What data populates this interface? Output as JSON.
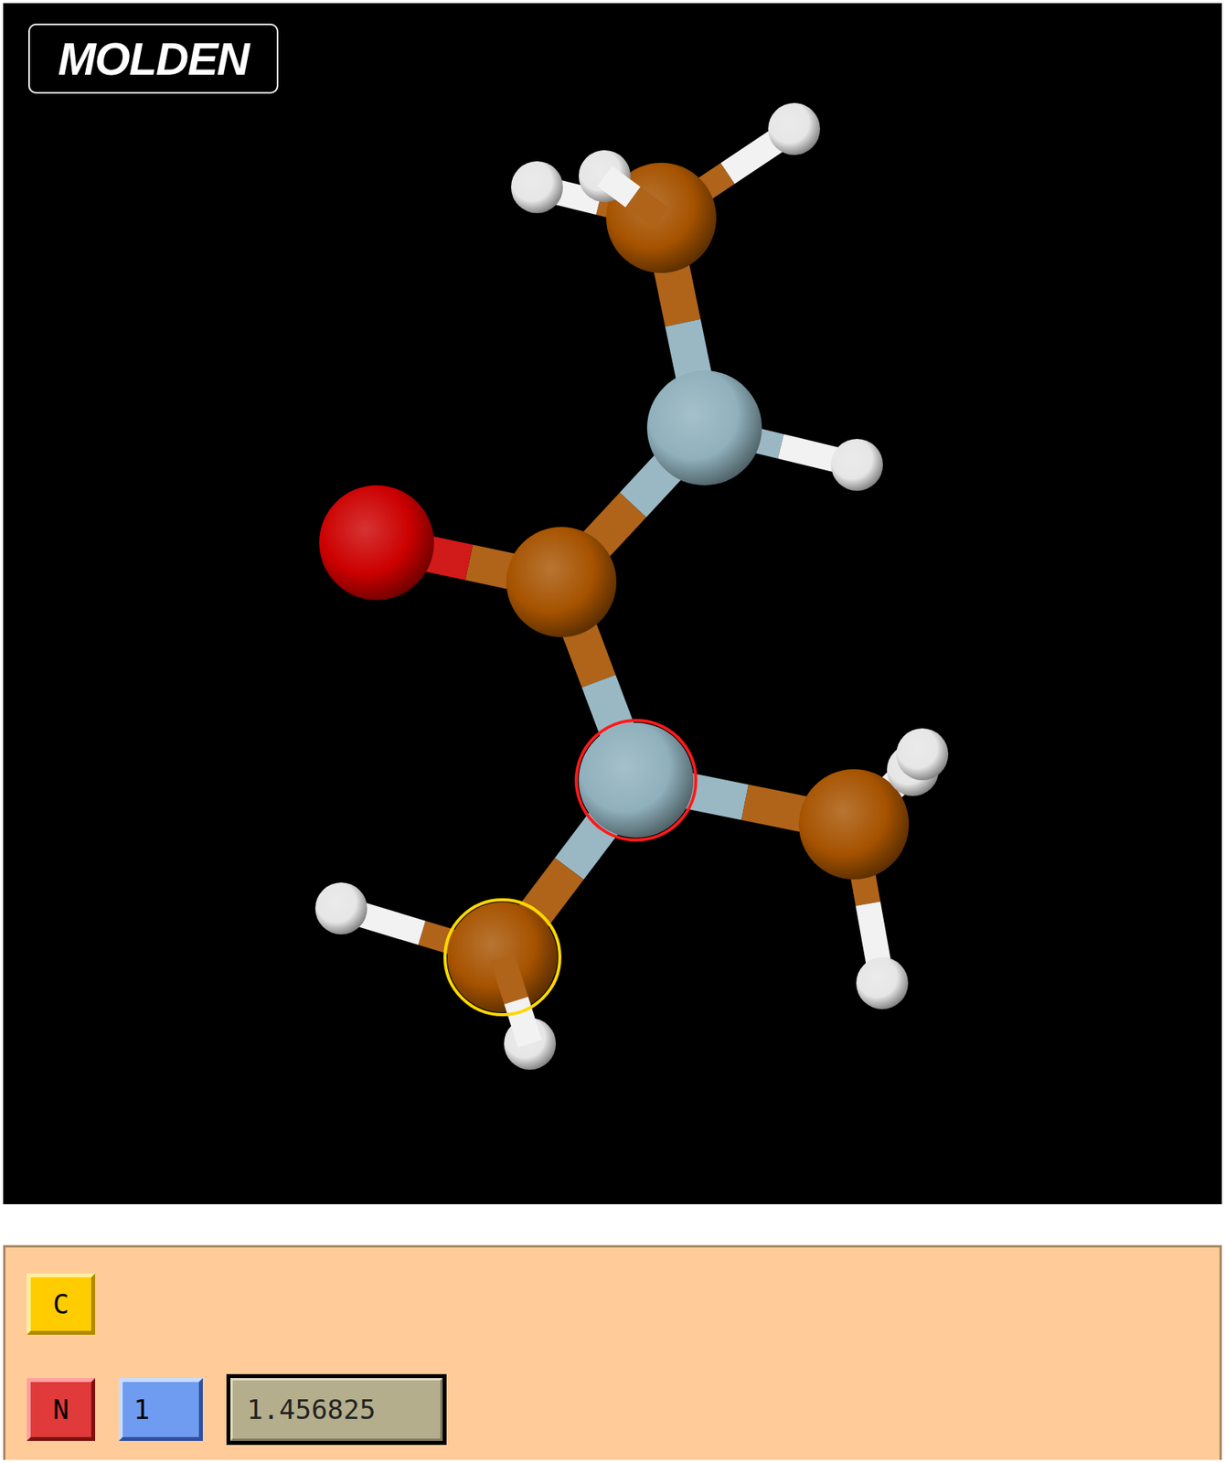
{
  "window": {
    "title": "MOLDEN"
  },
  "molecule": {
    "atoms": [
      {
        "element": "C",
        "color": "#a65300",
        "selected": false,
        "ring_color": ""
      },
      {
        "element": "H",
        "color": "#e6e6e6",
        "selected": false,
        "ring_color": ""
      },
      {
        "element": "H",
        "color": "#e6e6e6",
        "selected": false,
        "ring_color": ""
      },
      {
        "element": "H",
        "color": "#e6e6e6",
        "selected": false,
        "ring_color": ""
      },
      {
        "element": "N",
        "color": "#8fb0bc",
        "selected": false,
        "ring_color": ""
      },
      {
        "element": "H",
        "color": "#e6e6e6",
        "selected": false,
        "ring_color": ""
      },
      {
        "element": "O",
        "color": "#cc0000",
        "selected": false,
        "ring_color": ""
      },
      {
        "element": "C",
        "color": "#a65300",
        "selected": false,
        "ring_color": ""
      },
      {
        "element": "N",
        "color": "#8fb0bc",
        "selected": true,
        "ring_color": "#ff1a1a"
      },
      {
        "element": "C",
        "color": "#a65300",
        "selected": false,
        "ring_color": ""
      },
      {
        "element": "H",
        "color": "#e6e6e6",
        "selected": false,
        "ring_color": ""
      },
      {
        "element": "H",
        "color": "#e6e6e6",
        "selected": false,
        "ring_color": ""
      },
      {
        "element": "H",
        "color": "#e6e6e6",
        "selected": false,
        "ring_color": ""
      },
      {
        "element": "C",
        "color": "#a65300",
        "selected": true,
        "ring_color": "#ffd700"
      },
      {
        "element": "H",
        "color": "#e6e6e6",
        "selected": false,
        "ring_color": ""
      },
      {
        "element": "H",
        "color": "#e6e6e6",
        "selected": false,
        "ring_color": ""
      }
    ]
  },
  "panel": {
    "first_atom": {
      "label": "C",
      "color": "#ffcc00"
    },
    "second_atom": {
      "label": "N",
      "color": "#e03a3a"
    },
    "count": {
      "label": "1",
      "color": "#6f9cf0"
    },
    "distance": {
      "value": "1.456825"
    }
  }
}
